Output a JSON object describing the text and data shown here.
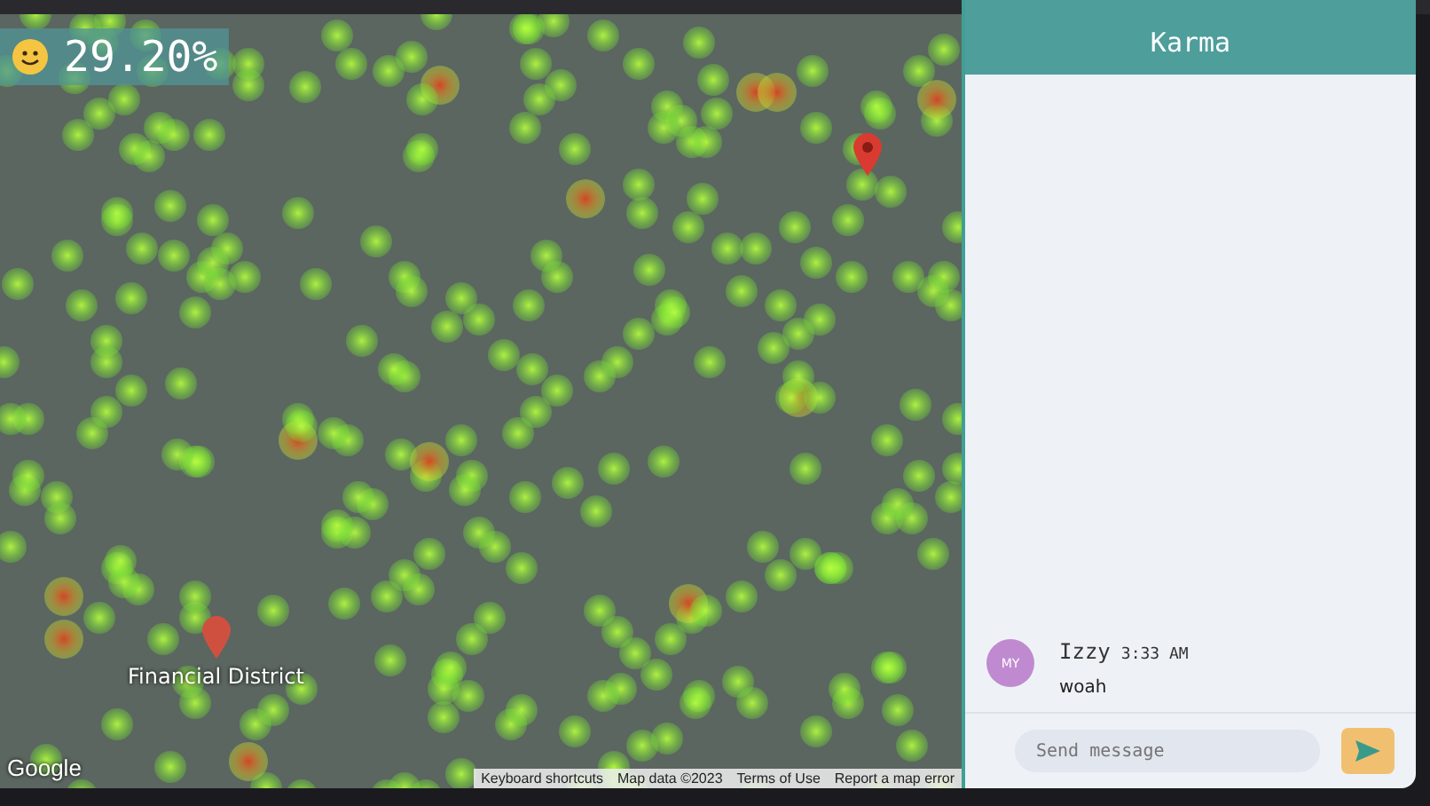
{
  "map": {
    "score": "29.20%",
    "place_label": "Financial District",
    "logo": "Google",
    "attribution": [
      "Keyboard shortcuts",
      "Map data ©2023",
      "Terms of Use",
      "Report a map error"
    ]
  },
  "chat": {
    "title": "Karma",
    "messages": [
      {
        "avatar": "MY",
        "author": "Izzy",
        "time": "3:33 AM",
        "text": "woah"
      }
    ],
    "input": {
      "placeholder": "Send message"
    }
  }
}
